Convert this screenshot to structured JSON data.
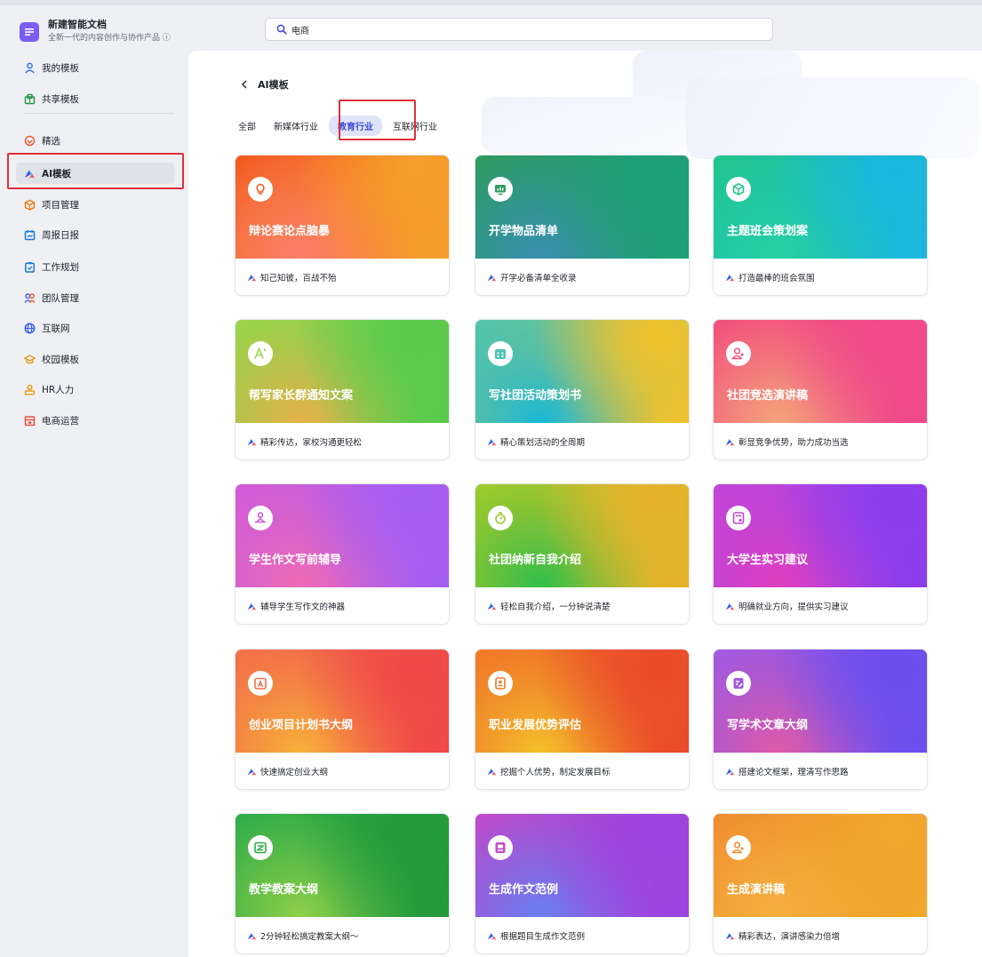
{
  "app": {
    "title": "新建智能文档",
    "subtitle": "全新一代的内容创作与协作产品 ⓘ"
  },
  "search": {
    "value": "电商",
    "placeholder": ""
  },
  "sidebar": {
    "items": [
      {
        "label": "我的模板",
        "icon": "user-icon"
      },
      {
        "label": "共享模板",
        "icon": "share-icon"
      },
      {
        "label": "精选",
        "icon": "heart-icon"
      },
      {
        "label": "AI模板",
        "icon": "ai-logo-icon"
      },
      {
        "label": "项目管理",
        "icon": "cube-icon"
      },
      {
        "label": "周报日报",
        "icon": "calendar-icon"
      },
      {
        "label": "工作规划",
        "icon": "clipboard-icon"
      },
      {
        "label": "团队管理",
        "icon": "team-icon"
      },
      {
        "label": "互联网",
        "icon": "globe-icon"
      },
      {
        "label": "校园模板",
        "icon": "graduation-icon"
      },
      {
        "label": "HR人力",
        "icon": "person-badge-icon"
      },
      {
        "label": "电商运营",
        "icon": "store-icon"
      }
    ]
  },
  "header": {
    "back_label": "AI模板"
  },
  "tabs": [
    {
      "label": "全部"
    },
    {
      "label": "新媒体行业"
    },
    {
      "label": "教育行业"
    },
    {
      "label": "互联网行业"
    }
  ],
  "colors": {
    "accent": "#3a4bd8",
    "highlight": "#e0303a",
    "ai_logo": "#4a63f0"
  },
  "cards": [
    {
      "title": "辩论赛论点脑暴",
      "desc": "知己知彼，百战不殆",
      "icon": "lightbulb-icon",
      "c1": "#f7a02a",
      "c2": "#f3581f",
      "c3": "#f97d6b"
    },
    {
      "title": "开学物品清单",
      "desc": "开学必备清单全收录",
      "icon": "chart-board-icon",
      "c1": "#1ea07a",
      "c2": "#2f9a5e",
      "c3": "#3a8fb0"
    },
    {
      "title": "主题班会策划案",
      "desc": "打造最棒的班会氛围",
      "icon": "cube-icon",
      "c1": "#19b7e0",
      "c2": "#22c48a",
      "c3": "#26d0a0"
    },
    {
      "title": "帮写家长群通知文案",
      "desc": "精彩传达，家校沟通更轻松",
      "icon": "text-style-icon",
      "c1": "#58c94c",
      "c2": "#9bd64a",
      "c3": "#e8b24a"
    },
    {
      "title": "写社团活动策划书",
      "desc": "精心策划活动的全周期",
      "icon": "calendar-icon",
      "c1": "#f2c22a",
      "c2": "#4cc4b0",
      "c3": "#18b8d8"
    },
    {
      "title": "社团竞选演讲稿",
      "desc": "彰显竞争优势，助力成功当选",
      "icon": "speaker-icon",
      "c1": "#f04a8a",
      "c2": "#f2507a",
      "c3": "#f4a47a"
    },
    {
      "title": "学生作文写前辅导",
      "desc": "辅导学生写作文的神器",
      "icon": "mentor-icon",
      "c1": "#a35ef2",
      "c2": "#d25ad8",
      "c3": "#f06ab4"
    },
    {
      "title": "社团纳新自我介绍",
      "desc": "轻松自我介绍，一分钟说清楚",
      "icon": "stopwatch-icon",
      "c1": "#e8b22a",
      "c2": "#9ccc2a",
      "c3": "#2fbf4a"
    },
    {
      "title": "大学生实习建议",
      "desc": "明确就业方向，提供实习建议",
      "icon": "resume-icon",
      "c1": "#8a3ef0",
      "c2": "#c446d8",
      "c3": "#e040c0"
    },
    {
      "title": "创业项目计划书大纲",
      "desc": "快速搞定创业大纲",
      "icon": "clipboard-a-icon",
      "c1": "#f04848",
      "c2": "#f2704a",
      "c3": "#f8b03a"
    },
    {
      "title": "职业发展优势评估",
      "desc": "挖掘个人优势，制定发展目标",
      "icon": "badge-icon",
      "c1": "#ea4a2a",
      "c2": "#f07a28",
      "c3": "#f4c02a"
    },
    {
      "title": "写学术文章大纲",
      "desc": "搭建论文框架，理清写作思路",
      "icon": "edit-doc-icon",
      "c1": "#6a4ef0",
      "c2": "#a45ae0",
      "c3": "#e05aa8"
    },
    {
      "title": "教学教案大纲",
      "desc": "2分钟轻松搞定教案大纲～",
      "icon": "lesson-board-icon",
      "c1": "#249a3a",
      "c2": "#2fae4a",
      "c3": "#8ed04a"
    },
    {
      "title": "生成作文范例",
      "desc": "根据题目生成作文范例",
      "icon": "essay-icon",
      "c1": "#9a44e0",
      "c2": "#c24ac8",
      "c3": "#6a7ef0"
    },
    {
      "title": "生成演讲稿",
      "desc": "精彩表达，演讲感染力倍增",
      "icon": "speaker-icon",
      "c1": "#f0a82a",
      "c2": "#f08a30",
      "c3": "#f4b040"
    }
  ]
}
